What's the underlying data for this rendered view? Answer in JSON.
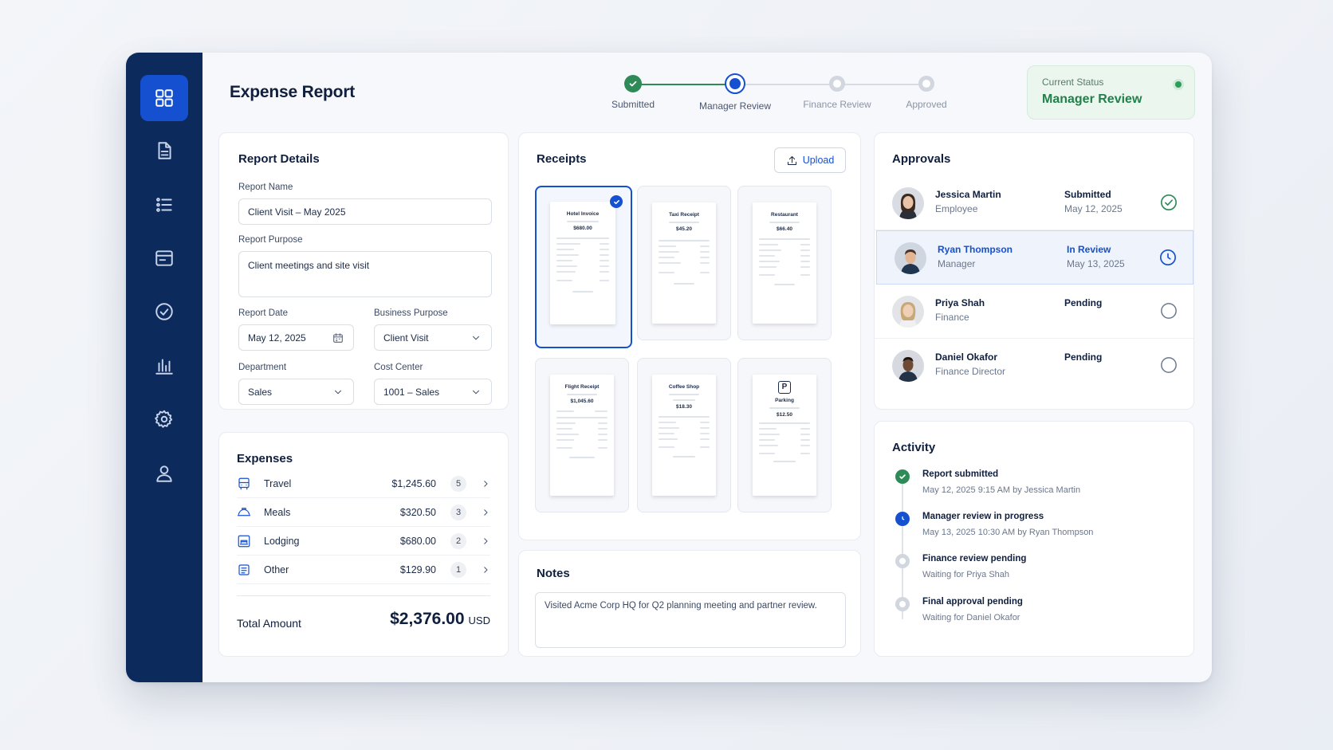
{
  "page": {
    "title": "Expense Report"
  },
  "stepper": {
    "steps": [
      {
        "label": "Submitted",
        "state": "done"
      },
      {
        "label": "Manager Review",
        "state": "current"
      },
      {
        "label": "Finance Review",
        "state": "pending"
      },
      {
        "label": "Approved",
        "state": "pending"
      }
    ]
  },
  "status": {
    "caption": "Current Status",
    "value": "Manager Review"
  },
  "sidebar": {
    "items": [
      {
        "icon": "dashboard-icon",
        "active": true
      },
      {
        "icon": "document-icon"
      },
      {
        "icon": "list-icon"
      },
      {
        "icon": "card-icon"
      },
      {
        "icon": "check-circle-icon"
      },
      {
        "icon": "chart-icon"
      },
      {
        "icon": "gear-icon"
      },
      {
        "icon": "user-icon"
      }
    ]
  },
  "details": {
    "title": "Report Details",
    "report_name_label": "Report Name",
    "report_name": "Client Visit – May 2025",
    "purpose_label": "Report Purpose",
    "purpose": "Client meetings and site visit",
    "date_label": "Report Date",
    "date": "May 12, 2025",
    "business_label": "Business Purpose",
    "business": "Client Visit",
    "dept_label": "Department",
    "dept": "Sales",
    "cost_label": "Cost Center",
    "cost": "1001 – Sales"
  },
  "expenses": {
    "title": "Expenses",
    "rows": [
      {
        "name": "Travel",
        "amount": "$1,245.60",
        "count": "5",
        "icon": "bus-icon"
      },
      {
        "name": "Meals",
        "amount": "$320.50",
        "count": "3",
        "icon": "meals-icon"
      },
      {
        "name": "Lodging",
        "amount": "$680.00",
        "count": "2",
        "icon": "hotel-icon"
      },
      {
        "name": "Other",
        "amount": "$129.90",
        "count": "1",
        "icon": "receipt-icon"
      }
    ],
    "total_label": "Total Amount",
    "total": "$2,376.00",
    "currency": "USD"
  },
  "receipts": {
    "title": "Receipts",
    "upload_label": "Upload",
    "items": [
      {
        "title": "Hotel Invoice",
        "amount": "$680.00",
        "selected": true
      },
      {
        "title": "Taxi Receipt",
        "amount": "$45.20"
      },
      {
        "title": "Restaurant",
        "amount": "$66.40"
      },
      {
        "title": "Flight Receipt",
        "amount": "$1,045.60"
      },
      {
        "title": "Coffee Shop",
        "amount": "$18.30"
      },
      {
        "title": "Parking",
        "amount": "$12.50"
      }
    ]
  },
  "notes": {
    "title": "Notes",
    "text": "Visited Acme Corp HQ for Q2 planning meeting and partner review."
  },
  "approvals": {
    "title": "Approvals",
    "rows": [
      {
        "name": "Jessica Martin",
        "role": "Employee",
        "state": "Submitted",
        "date": "May 12, 2025"
      },
      {
        "name": "Ryan Thompson",
        "role": "Manager",
        "state": "In Review",
        "date": "May 13, 2025"
      },
      {
        "name": "Priya Shah",
        "role": "Finance",
        "state": "Pending",
        "date": ""
      },
      {
        "name": "Daniel Okafor",
        "role": "Finance Director",
        "state": "Pending",
        "date": ""
      }
    ]
  },
  "activity": {
    "title": "Activity",
    "items": [
      {
        "title": "Report submitted",
        "sub": "May 12, 2025 9:15 AM by Jessica Martin",
        "state": "done"
      },
      {
        "title": "Manager review in progress",
        "sub": "May 13, 2025 10:30 AM by Ryan Thompson",
        "state": "current"
      },
      {
        "title": "Finance review pending",
        "sub": "Waiting for Priya Shah",
        "state": "pending"
      },
      {
        "title": "Final approval pending",
        "sub": "Waiting for Daniel Okafor",
        "state": "pending"
      }
    ]
  },
  "colors": {
    "primary": "#1550d1",
    "sidebar": "#0c2a5b",
    "success": "#2e8b57"
  }
}
